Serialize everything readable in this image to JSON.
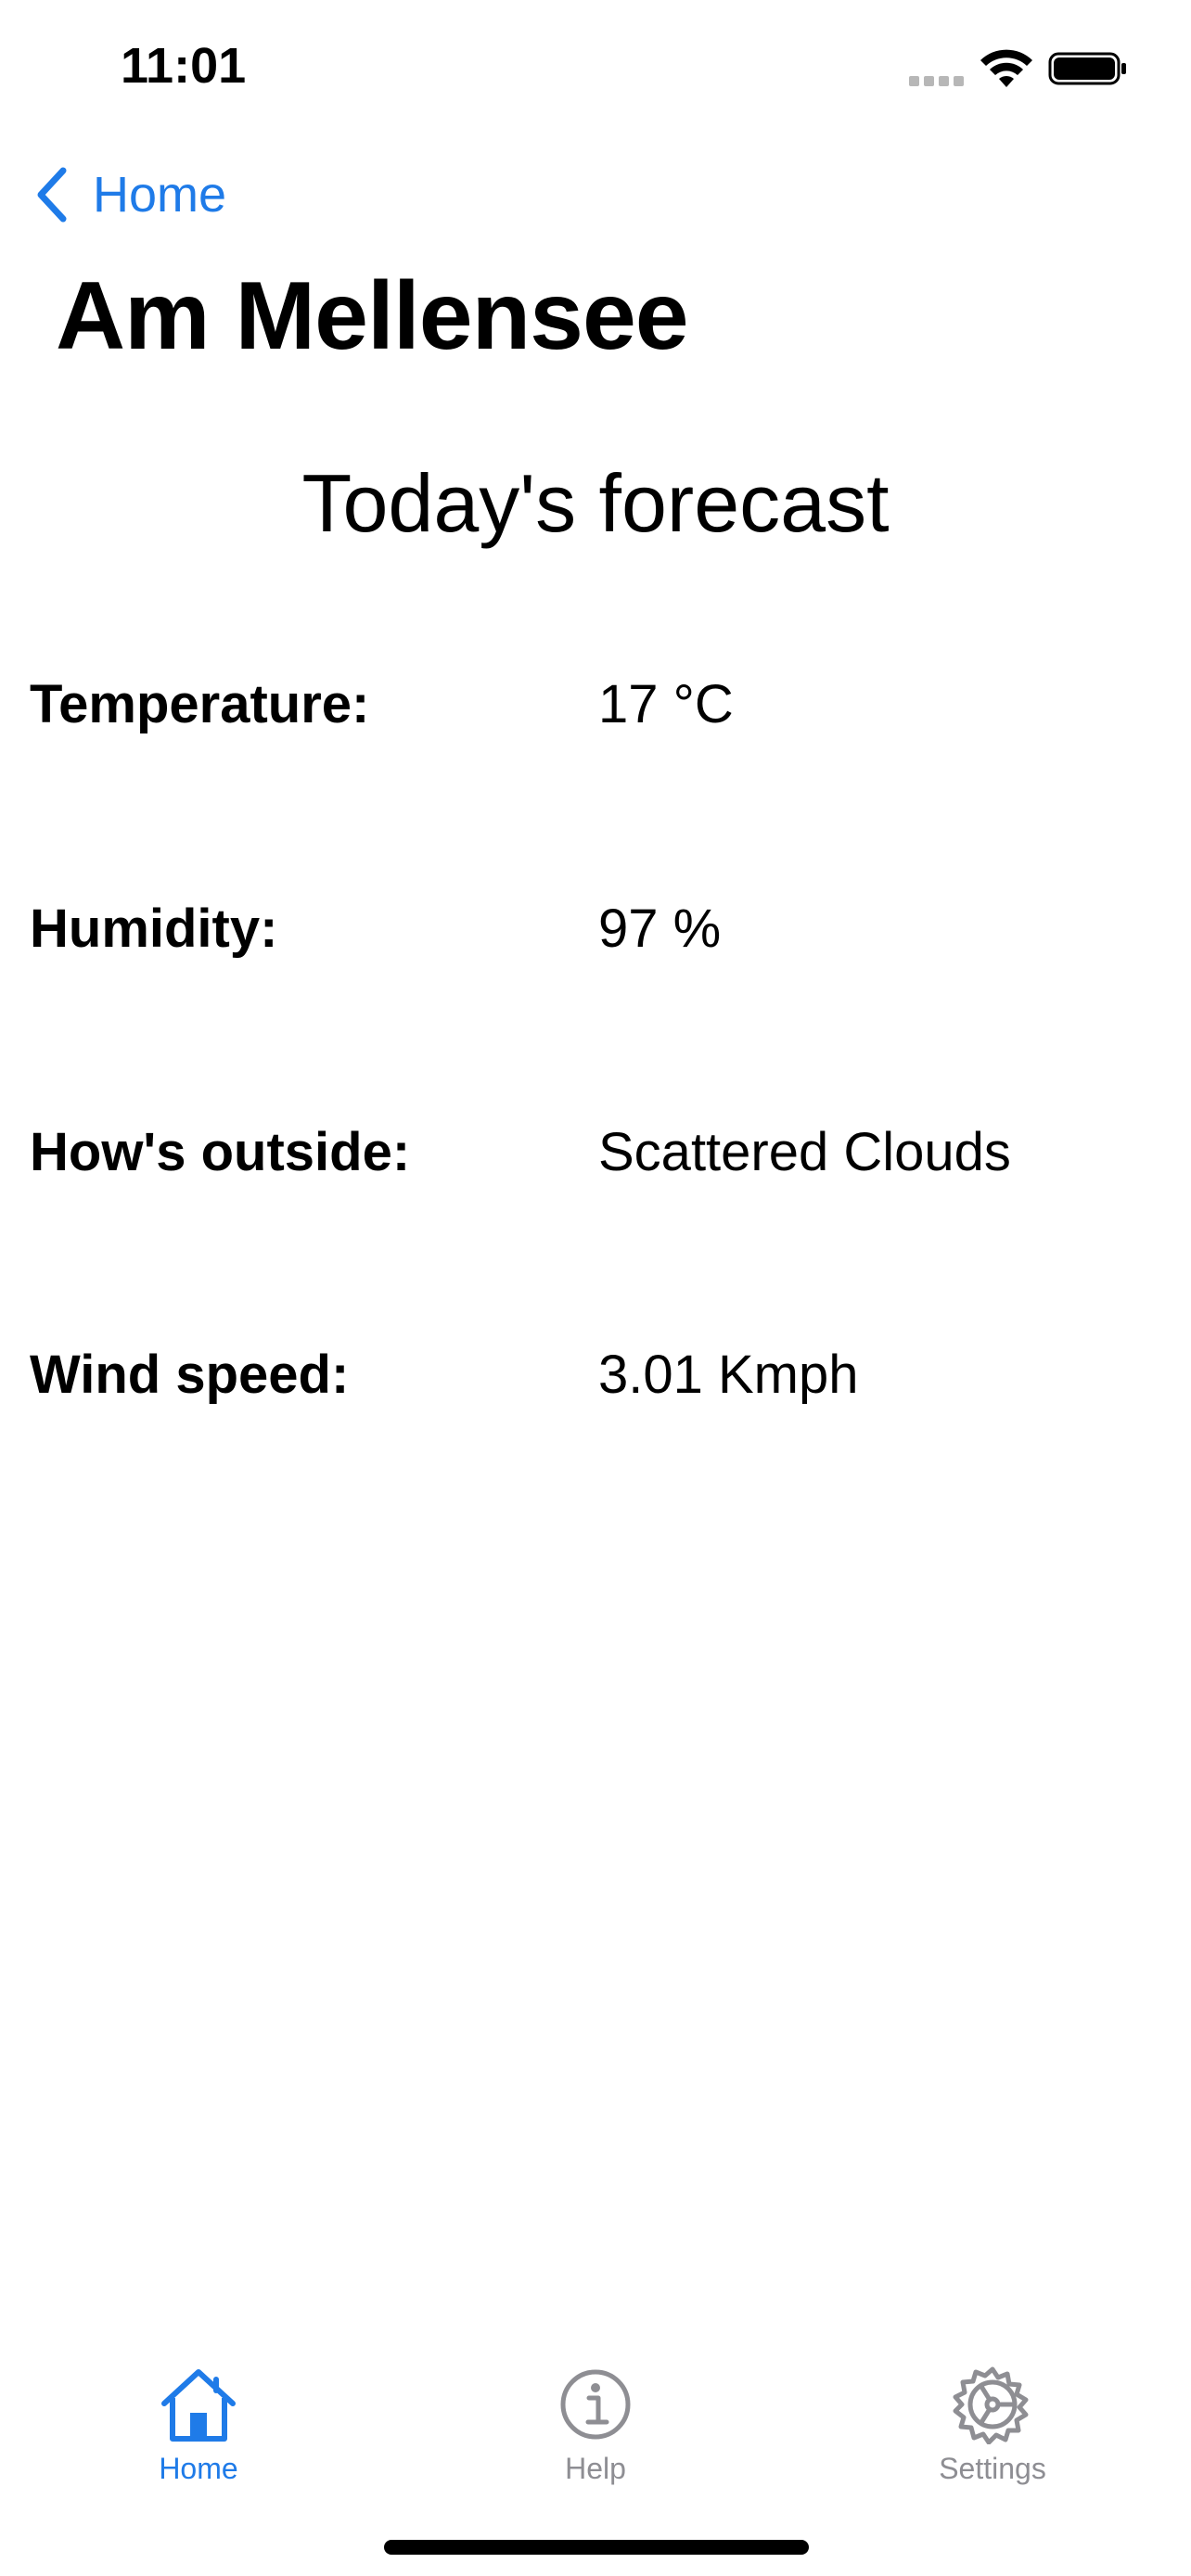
{
  "status_bar": {
    "time": "11:01",
    "icons": [
      "cellular-signal-icon",
      "wifi-icon",
      "battery-icon"
    ]
  },
  "nav": {
    "back_label": "Home",
    "back_icon": "chevron-left-icon"
  },
  "page": {
    "title": "Am Mellensee",
    "section_heading": "Today's forecast"
  },
  "forecast": [
    {
      "label": "Temperature:",
      "value": "17 °C"
    },
    {
      "label": "Humidity:",
      "value": "97 %"
    },
    {
      "label": "How's outside:",
      "value": "Scattered Clouds"
    },
    {
      "label": "Wind speed:",
      "value": "3.01 Kmph"
    }
  ],
  "tab_bar": {
    "items": [
      {
        "label": "Home",
        "icon": "house-icon",
        "active": true
      },
      {
        "label": "Help",
        "icon": "info-circle-icon",
        "active": false
      },
      {
        "label": "Settings",
        "icon": "gear-icon",
        "active": false
      }
    ]
  },
  "colors": {
    "accent": "#1f7be8",
    "inactive": "#8e8e93",
    "text": "#000000",
    "background": "#ffffff"
  }
}
